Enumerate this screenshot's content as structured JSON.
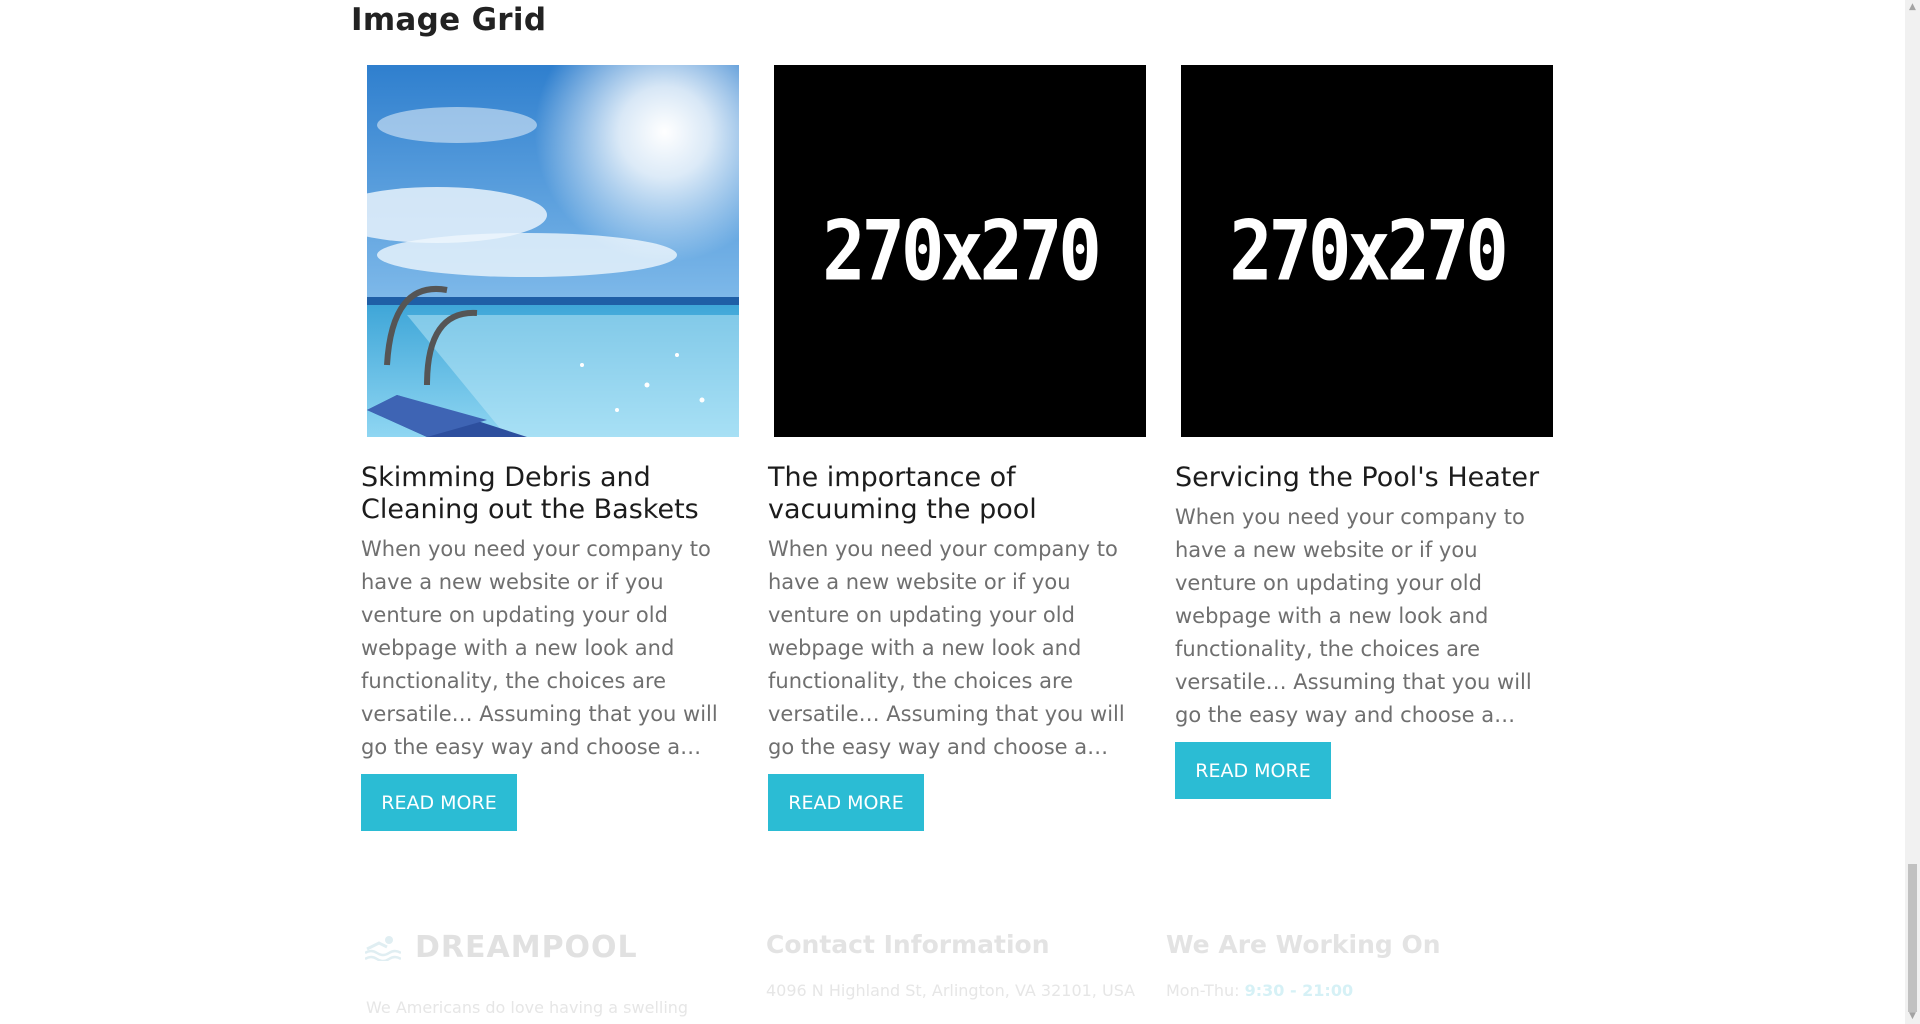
{
  "section": {
    "title": "Image Grid"
  },
  "cards": [
    {
      "image_label": "",
      "title": "Skimming Debris and Cleaning out the Baskets",
      "text": "When you need your company to have a new website or if you venture on updating your old webpage with a new look and functionality, the choices are versatile… Assuming that you will go the easy way and choose a…",
      "button": "READ MORE"
    },
    {
      "image_label": "270x270",
      "title": "The importance of vacuuming the pool",
      "text": "When you need your company to have a new website or if you venture on updating your old webpage with a new look and functionality, the choices are versatile… Assuming that you will go the easy way and choose a…",
      "button": "READ MORE"
    },
    {
      "image_label": "270x270",
      "title": "Servicing the Pool's Heater",
      "text": "When you need your company to have a new website or if you venture on updating your old webpage with a new look and functionality, the choices are versatile… Assuming that you will go the easy way and choose a…",
      "button": "READ MORE"
    }
  ],
  "footer": {
    "brand": "DREAMPOOL",
    "description": "We Americans do love having a swelling",
    "contact_heading": "Contact Information",
    "address": "4096 N Highland St, Arlington, VA 32101, USA",
    "hours_heading": "We Are Working On",
    "hours_days": "Mon-Thu:",
    "hours_time": "9:30 - 21:00"
  },
  "colors": {
    "accent": "#2bbcd4",
    "title": "#1c1c1c",
    "body_text": "#6f6f6f"
  }
}
